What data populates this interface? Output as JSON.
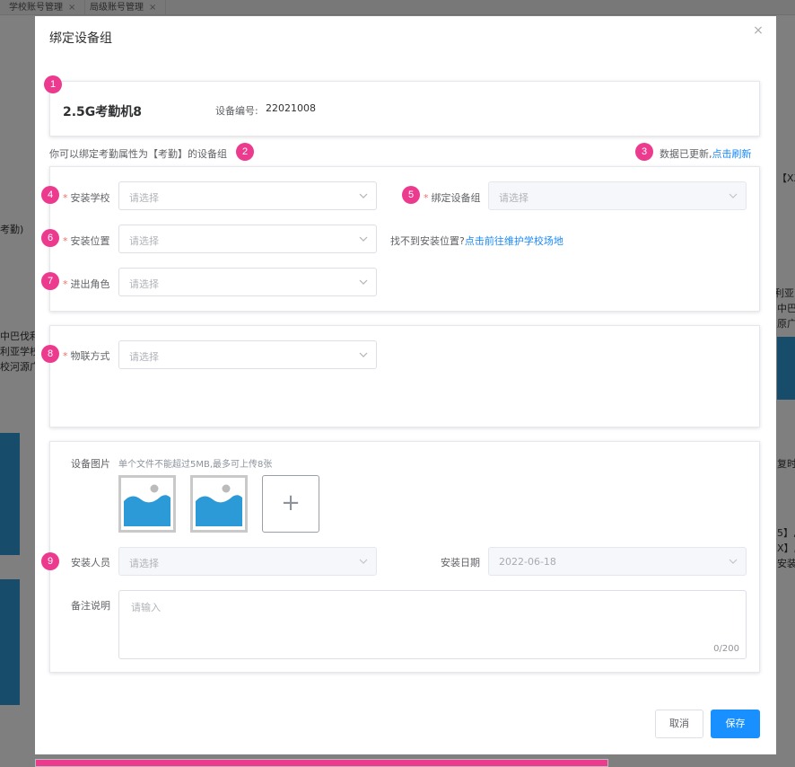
{
  "background": {
    "tabs": [
      {
        "label": "学校账号管理",
        "close": "×"
      },
      {
        "label": "局级账号管理",
        "close": "×"
      }
    ],
    "fragments_left": [
      "考勤)",
      "中巴伐利",
      "利亚学校",
      "校河源广"
    ],
    "fragments_right": [
      "【XX",
      "伐利亚",
      "中巴",
      "原广大",
      "复时间",
      "5】,",
      "X】,",
      "安装人"
    ]
  },
  "dialog": {
    "title": "绑定设备组",
    "close_icon": "×"
  },
  "device": {
    "name": "2.5G考勤机8",
    "code_label": "设备编号:",
    "code_value": "22021008"
  },
  "hints": {
    "bind_tip": "你可以绑定考勤属性为【考勤】的设备组",
    "updated": "数据已更新,",
    "refresh": "点击刷新",
    "location_missing": "找不到安装位置?",
    "location_link": "点击前往维护学校场地"
  },
  "form": {
    "school": {
      "label": "安装学校",
      "placeholder": "请选择"
    },
    "group": {
      "label": "绑定设备组",
      "placeholder": "请选择"
    },
    "location": {
      "label": "安装位置",
      "placeholder": "请选择"
    },
    "role": {
      "label": "进出角色",
      "placeholder": "请选择"
    },
    "iot": {
      "label": "物联方式",
      "placeholder": "请选择"
    },
    "images": {
      "label": "设备图片",
      "hint": "单个文件不能超过5MB,最多可上传8张",
      "add": "+"
    },
    "installer": {
      "label": "安装人员",
      "placeholder": "请选择"
    },
    "date": {
      "label": "安装日期",
      "value": "2022-06-18"
    },
    "remark": {
      "label": "备注说明",
      "placeholder": "请输入",
      "count": "0/200"
    }
  },
  "badges": [
    "1",
    "2",
    "3",
    "4",
    "5",
    "6",
    "7",
    "8",
    "9"
  ],
  "buttons": {
    "cancel": "取消",
    "save": "保存"
  },
  "colors": {
    "accent": "#1890ff",
    "badge": "#ec3a8e",
    "required": "#f56c6c"
  }
}
